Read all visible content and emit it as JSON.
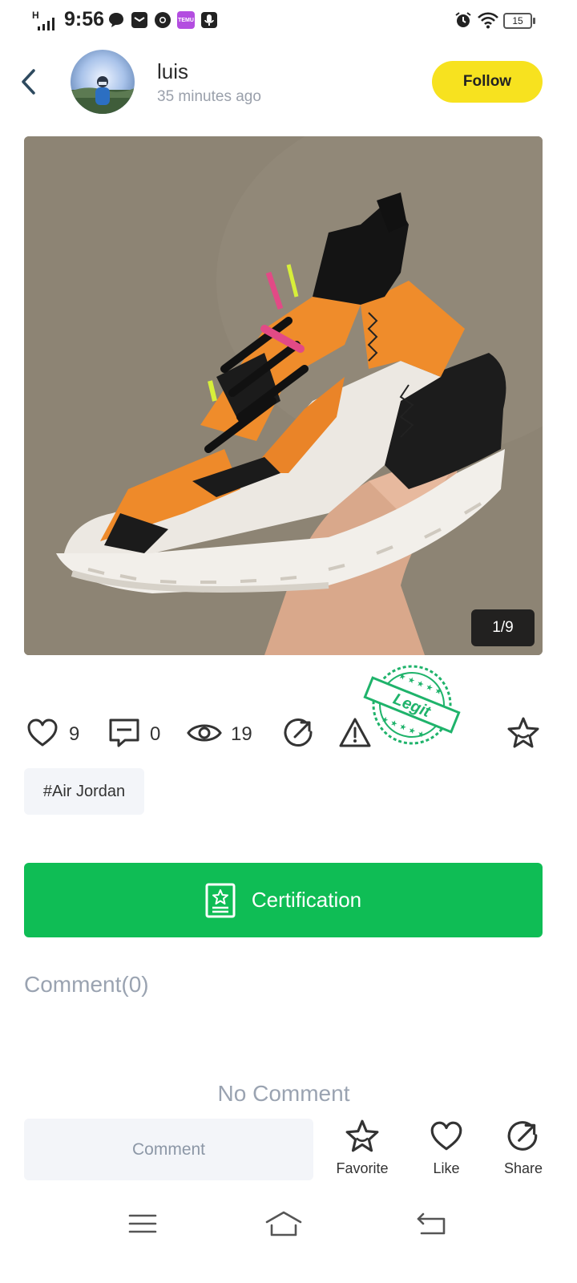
{
  "status_bar": {
    "time": "9:56",
    "network": "H",
    "battery": "15",
    "icons": [
      "signal-icon",
      "message-icon",
      "mail-icon",
      "chrome-icon",
      "temu-icon",
      "mic-icon",
      "alarm-icon",
      "wifi-icon",
      "battery-icon"
    ],
    "temu_label": "TEMU"
  },
  "header": {
    "username": "luis",
    "time_ago": "35 minutes ago",
    "follow_label": "Follow"
  },
  "photo": {
    "counter": "1/9",
    "subject": "orange, white and black basketball sneaker held in hand"
  },
  "stamp": {
    "text": "Legit",
    "color": "#1fb36b"
  },
  "stats": {
    "likes": "9",
    "comments": "0",
    "views": "19"
  },
  "tag": "#Air Jordan",
  "certification_label": "Certification",
  "comments": {
    "title": "Comment(0)",
    "empty": "No Comment"
  },
  "bottom_bar": {
    "input_placeholder": "Comment",
    "favorite": "Favorite",
    "like": "Like",
    "share": "Share"
  },
  "colors": {
    "follow": "#f7e21f",
    "certification": "#0fbd55",
    "muted_text": "#9aa3b1"
  }
}
